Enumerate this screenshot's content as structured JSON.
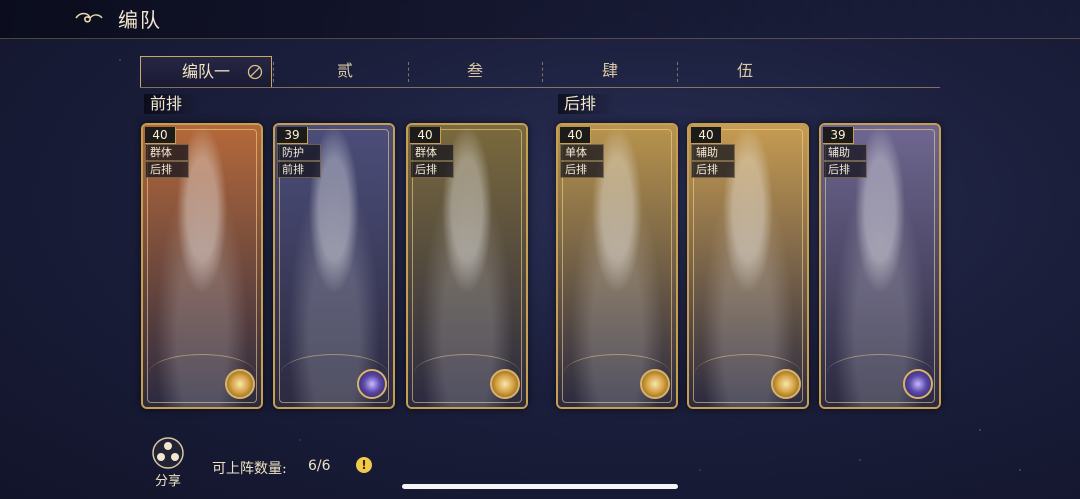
{
  "header": {
    "title": "编队"
  },
  "tabs": [
    {
      "label": "编队一",
      "active": true
    },
    {
      "label": "贰"
    },
    {
      "label": "叁"
    },
    {
      "label": "肆"
    },
    {
      "label": "伍"
    }
  ],
  "sections": {
    "front": "前排",
    "back": "后排"
  },
  "cards": [
    {
      "level": "40",
      "tag1": "群体",
      "tag2": "后排",
      "badge": "sun",
      "accent": "#b5693a"
    },
    {
      "level": "39",
      "tag1": "防护",
      "tag2": "前排",
      "badge": "moon",
      "accent": "#4c4e7a"
    },
    {
      "level": "40",
      "tag1": "群体",
      "tag2": "后排",
      "badge": "sun",
      "accent": "#7b6a3d"
    },
    {
      "level": "40",
      "tag1": "单体",
      "tag2": "后排",
      "badge": "sun",
      "accent": "#b8944d"
    },
    {
      "level": "40",
      "tag1": "辅助",
      "tag2": "后排",
      "badge": "sun",
      "accent": "#c79c52"
    },
    {
      "level": "39",
      "tag1": "辅助",
      "tag2": "后排",
      "badge": "moon",
      "accent": "#6f6790"
    }
  ],
  "footer": {
    "share_label": "分享",
    "count_label": "可上阵数量:",
    "count_value": "6/6",
    "info_icon": "!"
  }
}
